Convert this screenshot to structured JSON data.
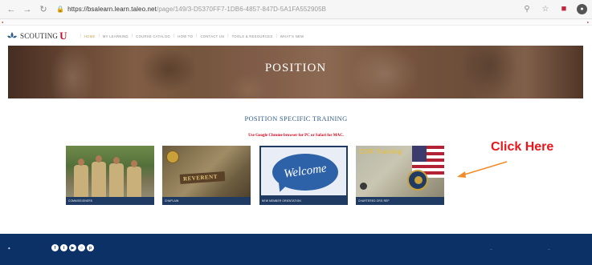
{
  "browser": {
    "url_host": "https://bsalearn.learn.taleo.net",
    "url_path": "/page/149/3-D5370FF7-1DB6-4857-847D-5A1FA552905B",
    "nav_icons": [
      "back-icon",
      "forward-icon",
      "reload-icon"
    ],
    "right_icons": [
      "zoom-icon",
      "star-icon",
      "extension-icon",
      "profile-icon"
    ]
  },
  "site_header": {
    "logo_text": "SCOUTING",
    "logo_u": "U",
    "nav": [
      "HOME",
      "MY LEARNING",
      "COURSE CATALOG",
      "HOW TO",
      "CONTACT US",
      "TOOLS & RESOURCES",
      "WHAT'S NEW"
    ]
  },
  "hero": {
    "title": "POSITION"
  },
  "content": {
    "section_title": "POSITION SPECIFIC TRAINING",
    "browser_note": "Use Google Chrome browser for PC or Safari for MAC."
  },
  "cards": [
    {
      "caption": "COMMISSIONERS"
    },
    {
      "caption": "CHAPLAIN",
      "image_text": "REVERENT"
    },
    {
      "caption": "NEW MEMBER ORIENTATION",
      "image_text": "Welcome"
    },
    {
      "caption": "CHARTERED ORG REP",
      "image_text": "COR Training"
    }
  ],
  "annotation": {
    "text": "Click Here",
    "color": "#e8161b",
    "arrow_color": "#f28c28"
  },
  "footer": {
    "background": "#0c3166",
    "social_icons": [
      "facebook-icon",
      "twitter-icon",
      "youtube-icon",
      "instagram-icon",
      "pinterest-icon"
    ]
  }
}
